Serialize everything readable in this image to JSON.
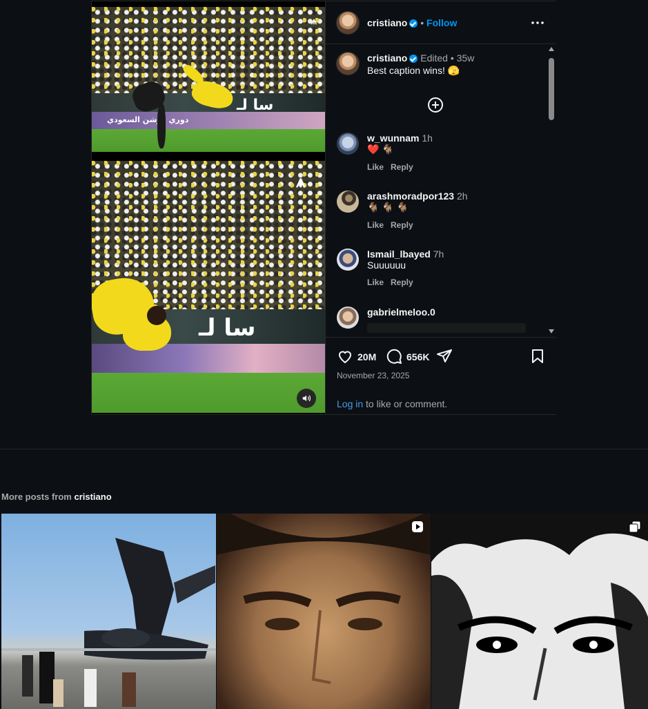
{
  "post": {
    "username": "cristiano",
    "follow_label": "Follow",
    "separator": "•",
    "more_icon": "more-horizontal-icon",
    "caption": {
      "username": "cristiano",
      "edited": "Edited",
      "dot": "•",
      "time": "35w",
      "text": "Best caption wins! 🫣"
    },
    "media_text": {
      "board_top": "سا لـ",
      "board_bottom": "دوري روشن السعودي"
    },
    "comments": [
      {
        "username": "w_wunnam",
        "time": "1h",
        "text": "❤️ 🐐",
        "like": "Like",
        "reply": "Reply"
      },
      {
        "username": "arashmoradpor123",
        "time": "2h",
        "text": "🐐 🐐 🐐",
        "like": "Like",
        "reply": "Reply"
      },
      {
        "username": "Ismail_lbayed",
        "time": "7h",
        "text": "Suuuuuu",
        "like": "Like",
        "reply": "Reply"
      },
      {
        "username": "gabrielmeloo.0",
        "time": "",
        "text": "",
        "like": "",
        "reply": ""
      }
    ],
    "likes_count": "20M",
    "comments_count": "656K",
    "date": "November 23, 2025",
    "login_link": "Log in",
    "login_rest": " to like or comment."
  },
  "more": {
    "prefix": "More posts from ",
    "username": "cristiano"
  },
  "colors": {
    "accent": "#0095f6",
    "background": "#0c1014",
    "border": "#262626"
  }
}
